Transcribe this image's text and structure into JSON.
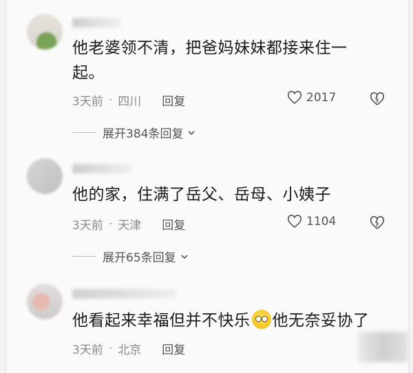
{
  "comments": [
    {
      "text": "他老婆领不清，把爸妈妹妹都接来住一起。",
      "time": "3天前",
      "separator": "·",
      "location": "四川",
      "reply_label": "回复",
      "likes": "2017",
      "expand_label": "展开384条回复"
    },
    {
      "text": "他的家，住满了岳父、岳母、小姨子",
      "time": "3天前",
      "separator": "·",
      "location": "天津",
      "reply_label": "回复",
      "likes": "1104",
      "expand_label": "展开65条回复"
    },
    {
      "text_before_emoji": "他看起来幸福但并不快乐",
      "text_after_emoji": "他无奈妥协了",
      "emoji": "smiling-face-emoji",
      "time": "3天前",
      "separator": "·",
      "location": "北京",
      "reply_label": "回复"
    }
  ],
  "icons": {
    "like": "heart-outline-icon",
    "dislike": "broken-heart-icon",
    "expand": "chevron-down-icon"
  },
  "colors": {
    "text": "#1a1a1a",
    "meta": "#8a8a8a",
    "background": "#fafafa"
  }
}
